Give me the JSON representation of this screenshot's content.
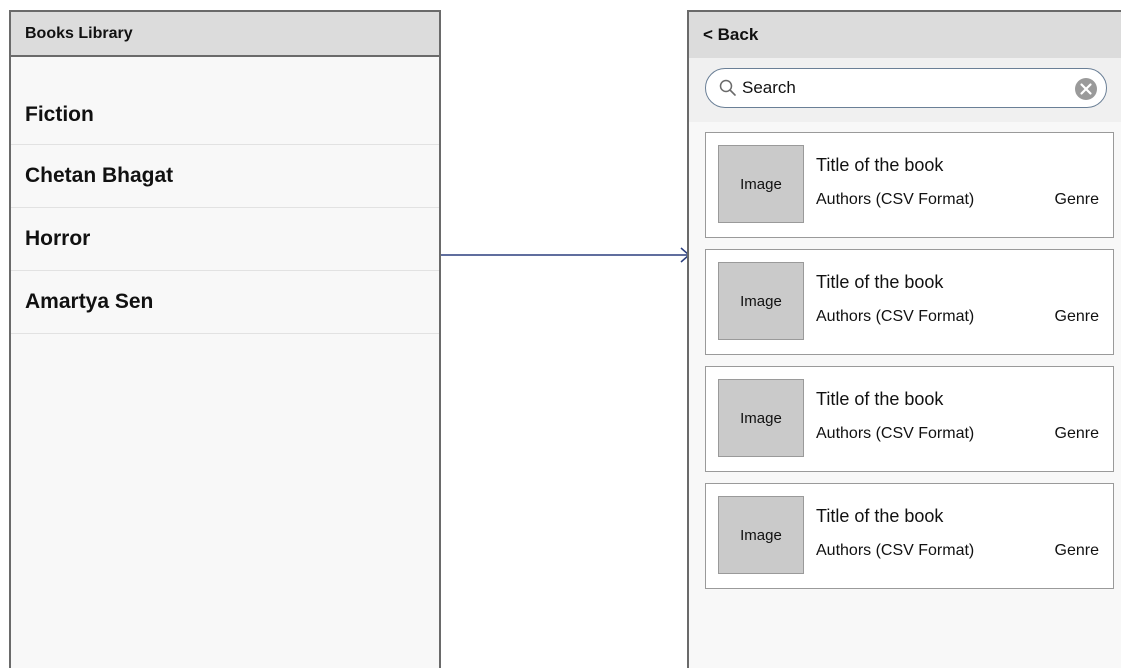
{
  "library_screen": {
    "title": "Books Library",
    "items": [
      {
        "label": "Fiction"
      },
      {
        "label": "Chetan Bhagat"
      },
      {
        "label": "Horror"
      },
      {
        "label": "Amartya Sen"
      }
    ]
  },
  "results_screen": {
    "back_label": "< Back",
    "search": {
      "placeholder": "Search",
      "value": ""
    },
    "books": [
      {
        "image_label": "Image",
        "title": "Title of the book",
        "authors": "Authors (CSV Format)",
        "genre": "Genre"
      },
      {
        "image_label": "Image",
        "title": "Title of the book",
        "authors": "Authors (CSV Format)",
        "genre": "Genre"
      },
      {
        "image_label": "Image",
        "title": "Title of the book",
        "authors": "Authors (CSV Format)",
        "genre": "Genre"
      },
      {
        "image_label": "Image",
        "title": "Title of the book",
        "authors": "Authors (CSV Format)",
        "genre": "Genre"
      }
    ]
  },
  "colors": {
    "header_bg": "#dcdcdc",
    "border": "#6a6a6a",
    "connector": "#2b3f7e",
    "image_placeholder": "#cacaca"
  }
}
